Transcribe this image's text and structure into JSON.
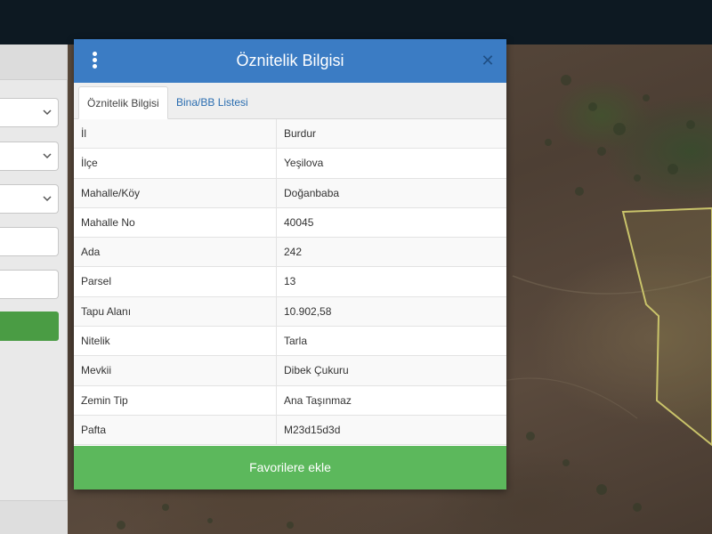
{
  "modal": {
    "title": "Öznitelik Bilgisi",
    "menu_icon": "vertical-dots-icon",
    "close_icon": "close-icon",
    "tabs": [
      {
        "label": "Öznitelik Bilgisi",
        "active": true
      },
      {
        "label": "Bina/BB Listesi",
        "active": false
      }
    ],
    "rows": [
      {
        "key": "İl",
        "value": "Burdur"
      },
      {
        "key": "İlçe",
        "value": "Yeşilova"
      },
      {
        "key": "Mahalle/Köy",
        "value": "Doğanbaba"
      },
      {
        "key": "Mahalle No",
        "value": "40045"
      },
      {
        "key": "Ada",
        "value": "242"
      },
      {
        "key": "Parsel",
        "value": "13"
      },
      {
        "key": "Tapu Alanı",
        "value": "10.902,58"
      },
      {
        "key": "Nitelik",
        "value": "Tarla"
      },
      {
        "key": "Mevkii",
        "value": "Dibek Çukuru"
      },
      {
        "key": "Zemin Tip",
        "value": "Ana Taşınmaz"
      },
      {
        "key": "Pafta",
        "value": "M23d15d3d"
      }
    ],
    "favorite_button": "Favorilere ekle"
  },
  "colors": {
    "header_blue": "#3b7cc4",
    "button_green": "#5cb85c",
    "parcel_outline": "#c9c36a",
    "topbar": "#0d1922"
  }
}
